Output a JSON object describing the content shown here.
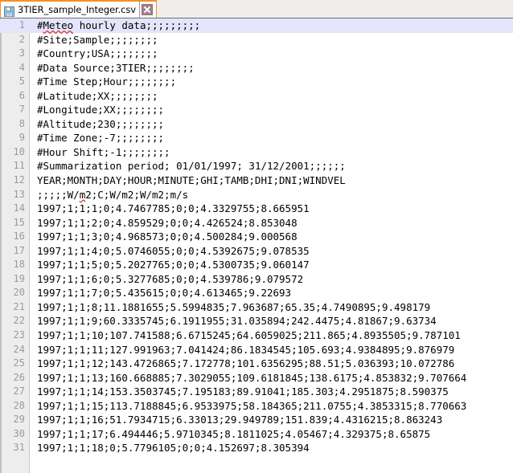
{
  "window": {
    "title": "3TIER_sample_Integer.csv",
    "accent_color": "#f59024",
    "close_icon_color": "#a6808c",
    "current_line_highlight": "#e4e4fa",
    "gutter_color": "#ededed",
    "linenumber_color": "#9a9a9a"
  },
  "tab": {
    "label": "3TIER_sample_Integer.csv",
    "file_icon": "save-floppy-icon",
    "close_icon": "close-x-icon"
  },
  "editor": {
    "current_line": 1,
    "first_visible_line": 1,
    "last_visible_line": 31,
    "lines": [
      {
        "n": "1",
        "text": "#Meteo hourly data;;;;;;;;;",
        "spell": "Meteo"
      },
      {
        "n": "2",
        "text": "#Site;Sample;;;;;;;;"
      },
      {
        "n": "3",
        "text": "#Country;USA;;;;;;;;"
      },
      {
        "n": "4",
        "text": "#Data Source;3TIER;;;;;;;;"
      },
      {
        "n": "5",
        "text": "#Time Step;Hour;;;;;;;;"
      },
      {
        "n": "6",
        "text": "#Latitude;XX;;;;;;;;"
      },
      {
        "n": "7",
        "text": "#Longitude;XX;;;;;;;;"
      },
      {
        "n": "8",
        "text": "#Altitude;230;;;;;;;;"
      },
      {
        "n": "9",
        "text": "#Time Zone;-7;;;;;;;;"
      },
      {
        "n": "10",
        "text": "#Hour Shift;-1;;;;;;;;"
      },
      {
        "n": "11",
        "text": "#Summarization period; 01/01/1997; 31/12/2001;;;;;;",
        "spell": "Summarization"
      },
      {
        "n": "12",
        "text": "YEAR;MONTH;DAY;HOUR;MINUTE;GHI;TAMB;DHI;DNI;WINDVEL"
      },
      {
        "n": "13",
        "text": ";;;;;W/m2;C;W/m2;W/m2;m/s",
        "spell": "m"
      },
      {
        "n": "14",
        "text": "1997;1;1;1;0;4.7467785;0;0;4.3329755;8.665951"
      },
      {
        "n": "15",
        "text": "1997;1;1;2;0;4.859529;0;0;4.426524;8.853048"
      },
      {
        "n": "16",
        "text": "1997;1;1;3;0;4.968573;0;0;4.500284;9.000568"
      },
      {
        "n": "17",
        "text": "1997;1;1;4;0;5.0746055;0;0;4.5392675;9.078535"
      },
      {
        "n": "18",
        "text": "1997;1;1;5;0;5.2027765;0;0;4.5300735;9.060147"
      },
      {
        "n": "19",
        "text": "1997;1;1;6;0;5.3277685;0;0;4.539786;9.079572"
      },
      {
        "n": "20",
        "text": "1997;1;1;7;0;5.435615;0;0;4.613465;9.22693"
      },
      {
        "n": "21",
        "text": "1997;1;1;8;11.1881655;5.5994835;7.963687;65.35;4.7490895;9.498179"
      },
      {
        "n": "22",
        "text": "1997;1;1;9;60.3335745;6.1911955;31.035894;242.4475;4.81867;9.63734"
      },
      {
        "n": "23",
        "text": "1997;1;1;10;107.741588;6.6715245;64.6059025;211.865;4.8935505;9.787101"
      },
      {
        "n": "24",
        "text": "1997;1;1;11;127.991963;7.041424;86.1834545;105.693;4.9384895;9.876979"
      },
      {
        "n": "25",
        "text": "1997;1;1;12;143.4726865;7.172778;101.6356295;88.51;5.036393;10.072786"
      },
      {
        "n": "26",
        "text": "1997;1;1;13;160.668885;7.3029055;109.6181845;138.6175;4.853832;9.707664"
      },
      {
        "n": "27",
        "text": "1997;1;1;14;153.3503745;7.195183;89.91041;185.303;4.2951875;8.590375"
      },
      {
        "n": "28",
        "text": "1997;1;1;15;113.7188845;6.9533975;58.184365;211.0755;4.3853315;8.770663"
      },
      {
        "n": "29",
        "text": "1997;1;1;16;51.7934715;6.33013;29.949789;151.839;4.4316215;8.863243"
      },
      {
        "n": "30",
        "text": "1997;1;1;17;6.494446;5.9710345;8.1811025;4.05467;4.329375;8.65875"
      },
      {
        "n": "31",
        "text": "1997;1;1;18;0;5.7796105;0;0;4.152697;8.305394"
      }
    ]
  }
}
